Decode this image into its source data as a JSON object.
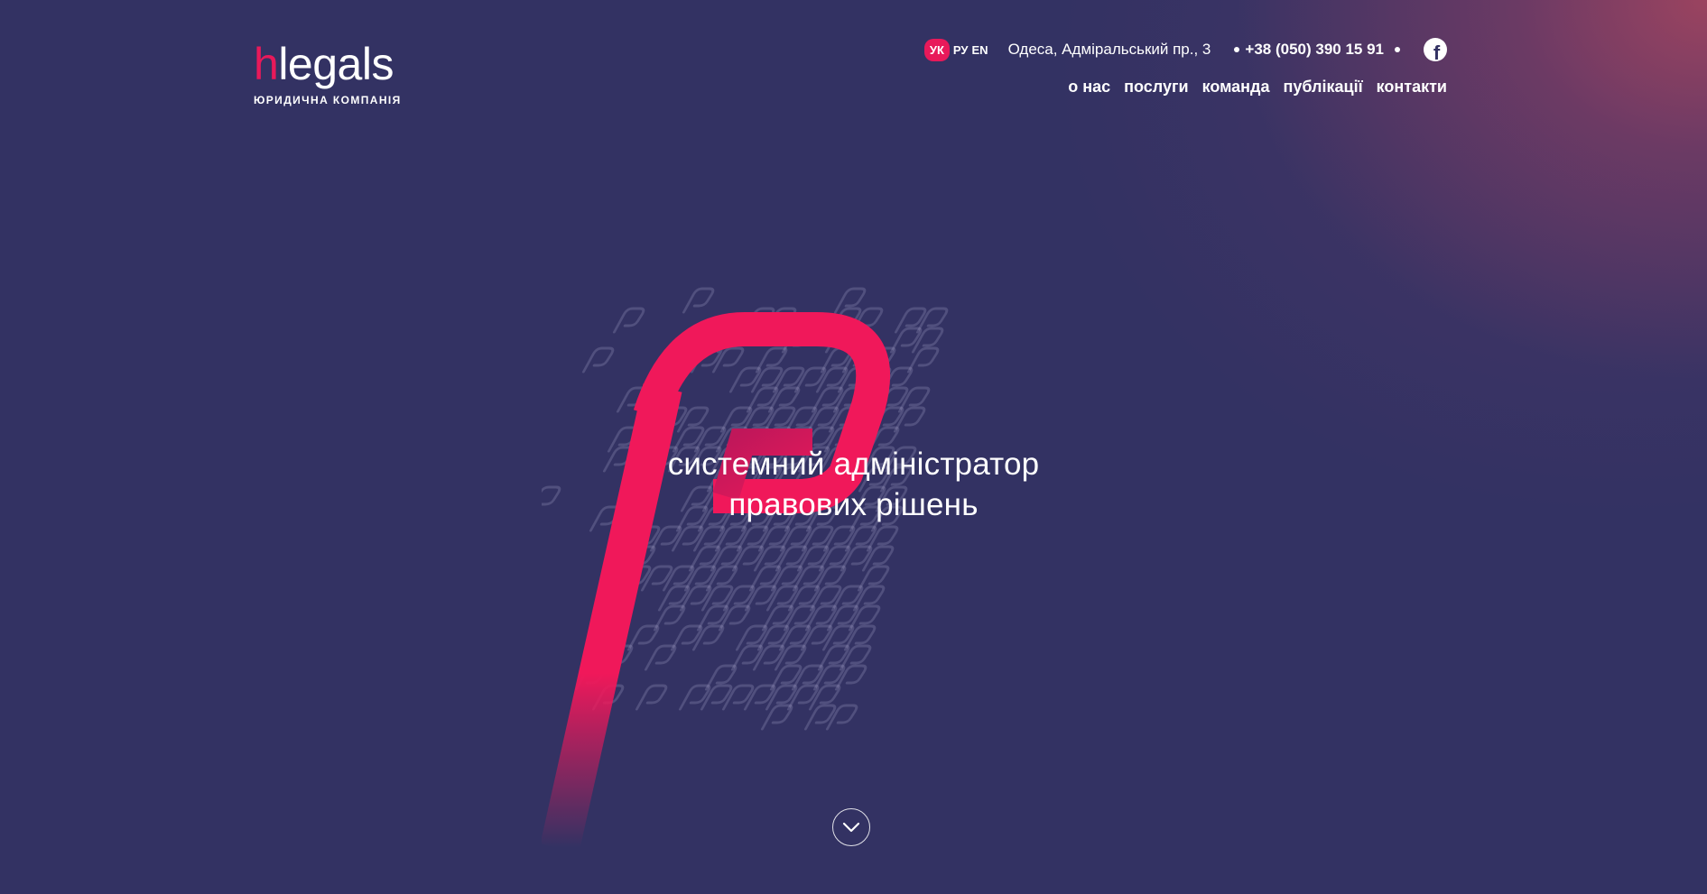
{
  "brand": {
    "logo_prefix": "h",
    "logo_rest": "legals",
    "tagline_small": "ЮРИДИЧНА КОМПАНІЯ",
    "accent_color": "#e8195a",
    "background_color": "#333263"
  },
  "topbar": {
    "languages": [
      {
        "code": "УК",
        "active": true
      },
      {
        "code": "РУ",
        "active": false
      },
      {
        "code": "EN",
        "active": false
      }
    ],
    "address": "Одеса, Адміральський пр., 3",
    "phone": "+38 (050) 390 15 91",
    "social_icon": "facebook-icon"
  },
  "nav": {
    "items": [
      "о нас",
      "послуги",
      "команда",
      "публікації",
      "контакти"
    ]
  },
  "hero": {
    "line1": "системний адміністратор",
    "line2": "правових рішень",
    "scroll_icon": "chevron-down-icon"
  }
}
